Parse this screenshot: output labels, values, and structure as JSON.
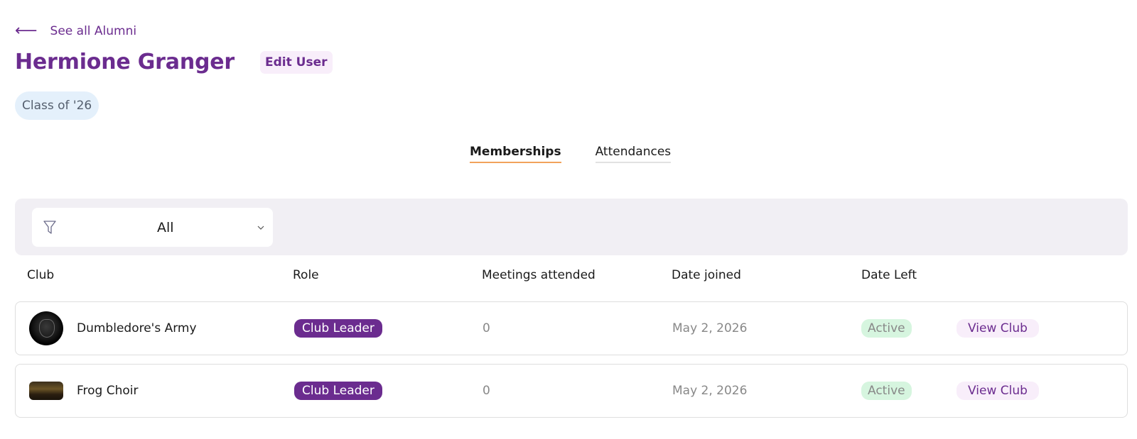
{
  "nav": {
    "back_label": "See all Alumni"
  },
  "header": {
    "title": "Hermione Granger",
    "edit_label": "Edit User",
    "class_badge": "Class of '26"
  },
  "tabs": [
    {
      "label": "Memberships",
      "active": true
    },
    {
      "label": "Attendances",
      "active": false
    }
  ],
  "filter": {
    "selected": "All"
  },
  "table": {
    "columns": [
      "Club",
      "Role",
      "Meetings attended",
      "Date joined",
      "Date Left"
    ],
    "rows": [
      {
        "club": "Dumbledore's Army",
        "role": "Club Leader",
        "meetings": "0",
        "date_joined": "May 2, 2026",
        "date_left": "Active",
        "action": "View Club"
      },
      {
        "club": "Frog Choir",
        "role": "Club Leader",
        "meetings": "0",
        "date_joined": "May 2, 2026",
        "date_left": "Active",
        "action": "View Club"
      }
    ]
  },
  "colors": {
    "accent": "#6b2c8f",
    "tab_underline": "#f2a25c",
    "active_bg": "#d6f5df",
    "badge_bg": "#e4f0fb"
  }
}
